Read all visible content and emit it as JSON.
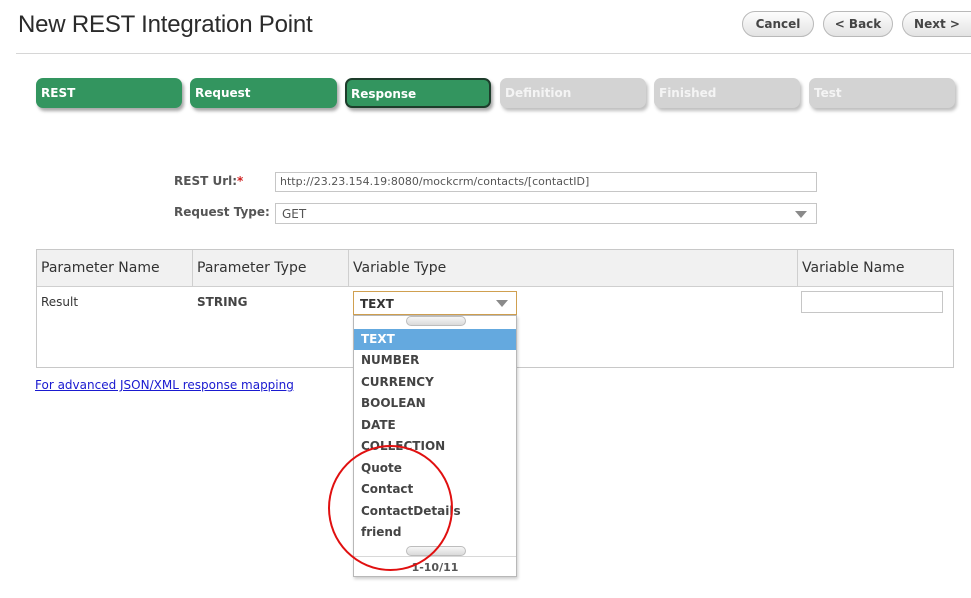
{
  "header": {
    "title": "New REST Integration Point",
    "cancel_label": "Cancel",
    "back_label": "< Back",
    "next_label": "Next >"
  },
  "steps": [
    {
      "label": "REST",
      "state": "done"
    },
    {
      "label": "Request",
      "state": "done"
    },
    {
      "label": "Response",
      "state": "active"
    },
    {
      "label": "Definition",
      "state": "todo"
    },
    {
      "label": "Finished",
      "state": "todo"
    },
    {
      "label": "Test",
      "state": "todo"
    }
  ],
  "form": {
    "rest_url_label": "REST Url:",
    "required_marker": "*",
    "rest_url_value": "http://23.23.154.19:8080/mockcrm/contacts/[contactID]",
    "request_type_label": "Request Type:",
    "request_type_value": "GET"
  },
  "grid": {
    "columns": [
      "Parameter Name",
      "Parameter Type",
      "Variable Type",
      "Variable Name"
    ],
    "rows": [
      {
        "parameter_name": "Result",
        "parameter_type": "STRING",
        "variable_type": "TEXT",
        "variable_name": ""
      }
    ]
  },
  "advanced_link": "For advanced JSON/XML response mapping",
  "dropdown": {
    "items": [
      "TEXT",
      "NUMBER",
      "CURRENCY",
      "BOOLEAN",
      "DATE",
      "COLLECTION",
      "Quote",
      "Contact",
      "ContactDetails",
      "friend"
    ],
    "selected": "TEXT",
    "footer": "1-10/11"
  },
  "colors": {
    "step_done": "#33955f",
    "step_todo": "#d3d3d3",
    "selected_item": "#64a9df",
    "link": "#1a1ad0",
    "annotation": "#e01010"
  }
}
